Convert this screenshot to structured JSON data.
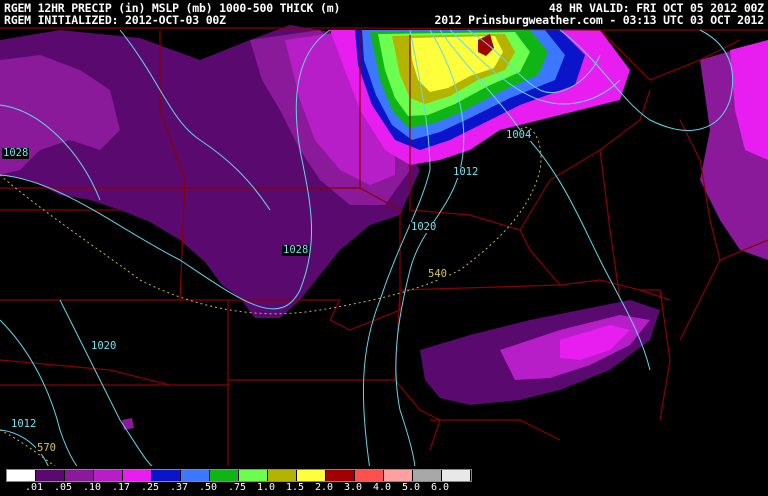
{
  "header": {
    "line1_left": "RGEM 12HR PRECIP (in) MSLP (mb) 1000-500 THICK (m)",
    "line2_left": "RGEM INITIALIZED: 2012-OCT-03 00Z",
    "line1_right": "48 HR VALID: FRI OCT 05 2012 00Z",
    "line2_right": "2012 Prinsburgweather.com - 03:13 UTC 03 OCT 2012"
  },
  "isobar_labels": [
    {
      "id": "iso-1028-w",
      "text": "1028"
    },
    {
      "id": "iso-1004",
      "text": "1004"
    },
    {
      "id": "iso-1012-c",
      "text": "1012"
    },
    {
      "id": "iso-1020-c",
      "text": "1020"
    },
    {
      "id": "iso-1028-c",
      "text": "1028"
    },
    {
      "id": "iso-1020-sw",
      "text": "1020"
    },
    {
      "id": "iso-1012-sw",
      "text": "1012"
    }
  ],
  "thickness_labels": [
    {
      "id": "thick-540",
      "text": "540"
    },
    {
      "id": "thick-570",
      "text": "570"
    }
  ],
  "legend": {
    "colors": [
      "#ffffff",
      "#5a0a6e",
      "#8a1a9a",
      "#b81ec8",
      "#e81ef0",
      "#0a14c8",
      "#3c78ff",
      "#10b414",
      "#6cff50",
      "#b4b400",
      "#ffff3c",
      "#a00000",
      "#ff5050",
      "#ffa0a0",
      "#a8a8a8",
      "#e8e8e8"
    ],
    "labels": [
      ".01",
      ".05",
      ".10",
      ".17",
      ".25",
      ".37",
      ".50",
      ".75",
      "1.0",
      "1.5",
      "2.0",
      "3.0",
      "4.0",
      "5.0",
      "6.0"
    ]
  }
}
